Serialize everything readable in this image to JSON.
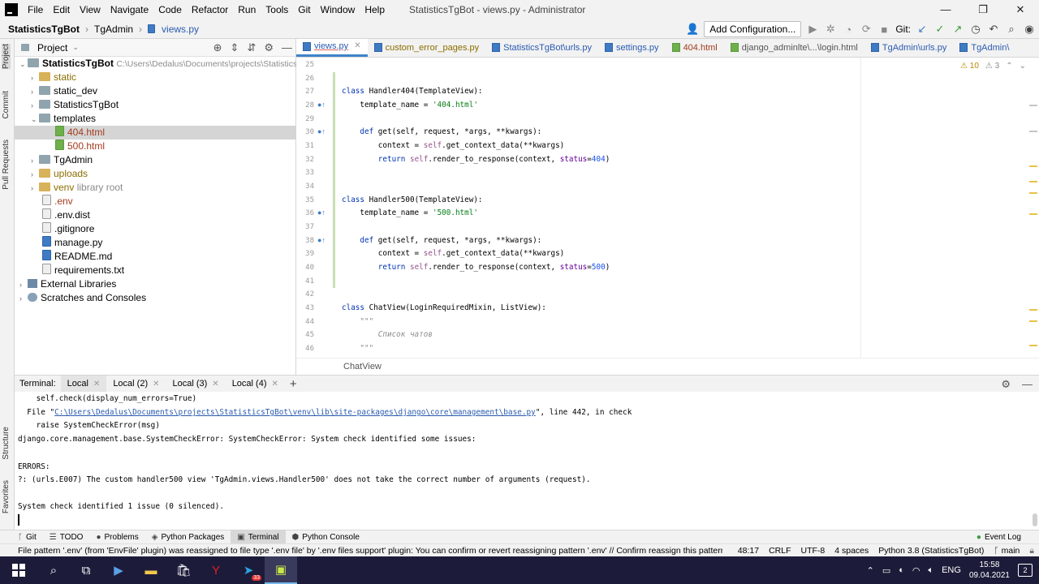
{
  "app": {
    "menu": [
      "File",
      "Edit",
      "View",
      "Navigate",
      "Code",
      "Refactor",
      "Run",
      "Tools",
      "Git",
      "Window",
      "Help"
    ],
    "window_title": "StatisticsTgBot - views.py - Administrator",
    "window_controls": [
      "—",
      "❐",
      "✕"
    ]
  },
  "navbar": {
    "crumbs": [
      "StatisticsTgBot",
      "TgAdmin",
      "views.py"
    ],
    "add_configuration": "Add Configuration...",
    "git_label": "Git:"
  },
  "side_tabs": {
    "project": "Project",
    "commit": "Commit",
    "pull_requests": "Pull Requests",
    "structure": "Structure",
    "favorites": "Favorites"
  },
  "project": {
    "title": "Project",
    "root_name": "StatisticsTgBot",
    "root_path": "C:\\Users\\Dedalus\\Documents\\projects\\StatisticsTgBot",
    "items": [
      {
        "name": "static",
        "type": "folder-excluded",
        "arrow": "›"
      },
      {
        "name": "static_dev",
        "type": "folder",
        "arrow": "›"
      },
      {
        "name": "StatisticsTgBot",
        "type": "folder",
        "arrow": "›"
      },
      {
        "name": "templates",
        "type": "folder",
        "arrow": "⌄"
      },
      {
        "name": "404.html",
        "type": "html"
      },
      {
        "name": "500.html",
        "type": "html"
      },
      {
        "name": "TgAdmin",
        "type": "folder",
        "arrow": "›"
      },
      {
        "name": "uploads",
        "type": "folder-excluded",
        "arrow": "›"
      },
      {
        "name": "venv",
        "type": "folder-excluded",
        "arrow": "›",
        "note": "library root"
      },
      {
        "name": ".env",
        "type": "file"
      },
      {
        "name": ".env.dist",
        "type": "file"
      },
      {
        "name": ".gitignore",
        "type": "file"
      },
      {
        "name": "manage.py",
        "type": "py"
      },
      {
        "name": "README.md",
        "type": "md"
      },
      {
        "name": "requirements.txt",
        "type": "file"
      }
    ],
    "external_libraries": "External Libraries",
    "scratches": "Scratches and Consoles"
  },
  "tabs": [
    "views.py",
    "custom_error_pages.py",
    "StatisticsTgBot\\urls.py",
    "settings.py",
    "404.html",
    "django_adminlte\\...\\login.html",
    "TgAdmin\\urls.py",
    "TgAdmin\\"
  ],
  "editor": {
    "inspection_warnings": "10",
    "inspection_weak": "3",
    "line_numbers": [
      "25",
      "26",
      "27",
      "28",
      "29",
      "30",
      "31",
      "32",
      "33",
      "34",
      "35",
      "36",
      "37",
      "38",
      "39",
      "40",
      "41",
      "42",
      "43",
      "44",
      "45",
      "46"
    ],
    "code": {
      "l27_kw": "class ",
      "l27_rest": "Handler404(TemplateView):",
      "l28_a": "    template_name = ",
      "l28_str": "'404.html'",
      "l30_kw": "    def ",
      "l30_rest": "get(self, request, *args, **kwargs):",
      "l31_a": "        context = ",
      "l31_self": "self",
      "l31_b": ".get_context_data(**kwargs)",
      "l32_kw": "        return ",
      "l32_self": "self",
      "l32_b": ".render_to_response(context, ",
      "l32_kwarg": "status",
      "l32_eq": "=",
      "l32_num": "404",
      "l32_end": ")",
      "l35_kw": "class ",
      "l35_rest": "Handler500(TemplateView):",
      "l36_a": "    template_name = ",
      "l36_str": "'500.html'",
      "l38_kw": "    def ",
      "l38_rest": "get(self, request, *args, **kwargs):",
      "l39_a": "        context = ",
      "l39_self": "self",
      "l39_b": ".get_context_data(**kwargs)",
      "l40_kw": "        return ",
      "l40_self": "self",
      "l40_b": ".render_to_response(context, ",
      "l40_kwarg": "status",
      "l40_eq": "=",
      "l40_num": "500",
      "l40_end": ")",
      "l43_kw": "class ",
      "l43_rest": "ChatView(LoginRequiredMixin, ListView):",
      "l44_doc": "    \"\"\"",
      "l45_doc": "        Список чатов",
      "l46_doc": "    \"\"\""
    },
    "breadcrumb": "ChatView"
  },
  "terminal": {
    "label": "Terminal:",
    "tabs": [
      "Local",
      "Local (2)",
      "Local (3)",
      "Local (4)"
    ],
    "add_tab": "+",
    "lines": {
      "l1": "    self.check(display_num_errors=True)",
      "l2_a": "  File \"",
      "l2_link": "C:\\Users\\Dedalus\\Documents\\projects\\StatisticsTgBot\\venv\\lib\\site-packages\\django\\core\\management\\base.py",
      "l2_b": "\", line 442, in check",
      "l3": "    raise SystemCheckError(msg)",
      "l4": "django.core.management.base.SystemCheckError: SystemCheckError: System check identified some issues:",
      "l5": "ERRORS:",
      "l6": "?: (urls.E007) The custom handler500 view 'TgAdmin.views.Handler500' does not take the correct number of arguments (request).",
      "l7": "System check identified 1 issue (0 silenced)."
    }
  },
  "toolwindows": [
    "Git",
    "TODO",
    "Problems",
    "Python Packages",
    "Terminal",
    "Python Console"
  ],
  "event_log": "Event Log",
  "status": {
    "message": "File pattern '.env' (from 'EnvFile' plugin) was reassigned to file type '.env file' by '.env files support' plugin: You can confirm or revert reassigning pattern '.env' // Confirm reassign this pattern to fil... (today",
    "position": "48:17",
    "line_sep": "CRLF",
    "encoding": "UTF-8",
    "indent": "4 spaces",
    "interpreter": "Python 3.8 (StatisticsTgBot)",
    "branch": "main"
  },
  "taskbar": {
    "lang": "ENG",
    "time": "15:58",
    "date": "09.04.2021",
    "notifications": "2",
    "telegram_badge": "33"
  },
  "colors": {
    "accent": "#4083c9",
    "taskbar": "#1c1c3a",
    "keyword": "#0033b3",
    "string": "#067d17",
    "number": "#1750eb"
  }
}
